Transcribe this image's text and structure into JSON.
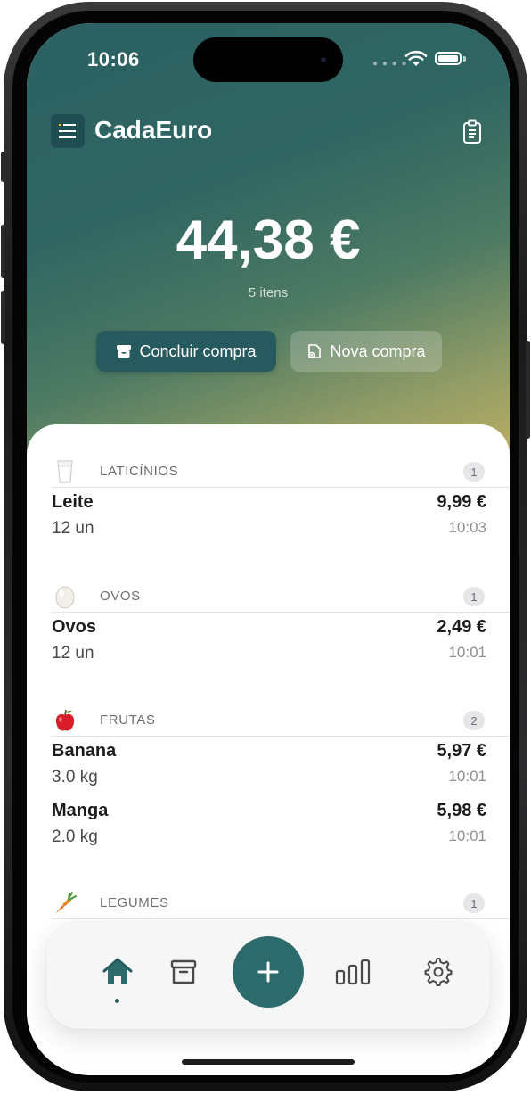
{
  "status": {
    "time": "10:06"
  },
  "header": {
    "title": "CadaEuro",
    "menu_icon": "menu-icon",
    "right_icon": "clipboard-icon"
  },
  "summary": {
    "total": "44,38 €",
    "items_count": "5 itens"
  },
  "actions": {
    "primary_label": "Concluir compra",
    "secondary_label": "Nova compra"
  },
  "categories": [
    {
      "emoji": "milk-glass-icon",
      "name": "LATICÍNIOS",
      "count": "1",
      "items": [
        {
          "name": "Leite",
          "qty": "12 un",
          "price": "9,99 €",
          "time": "10:03"
        }
      ]
    },
    {
      "emoji": "egg-icon",
      "name": "OVOS",
      "count": "1",
      "items": [
        {
          "name": "Ovos",
          "qty": "12 un",
          "price": "2,49 €",
          "time": "10:01"
        }
      ]
    },
    {
      "emoji": "apple-icon",
      "name": "FRUTAS",
      "count": "2",
      "items": [
        {
          "name": "Banana",
          "qty": "3.0 kg",
          "price": "5,97 €",
          "time": "10:01"
        },
        {
          "name": "Manga",
          "qty": "2.0 kg",
          "price": "5,98 €",
          "time": "10:01"
        }
      ]
    },
    {
      "emoji": "carrot-icon",
      "name": "LEGUMES",
      "count": "1",
      "items": []
    }
  ],
  "tabbar": {
    "tabs": [
      "home-icon",
      "archive-icon",
      "plus-icon",
      "stats-icon",
      "settings-icon"
    ],
    "active": "home"
  },
  "colors": {
    "accent": "#2d6a6c",
    "button_dark": "#275a5e",
    "gradient_top": "#2c6163",
    "gradient_bottom": "#c7b462"
  }
}
